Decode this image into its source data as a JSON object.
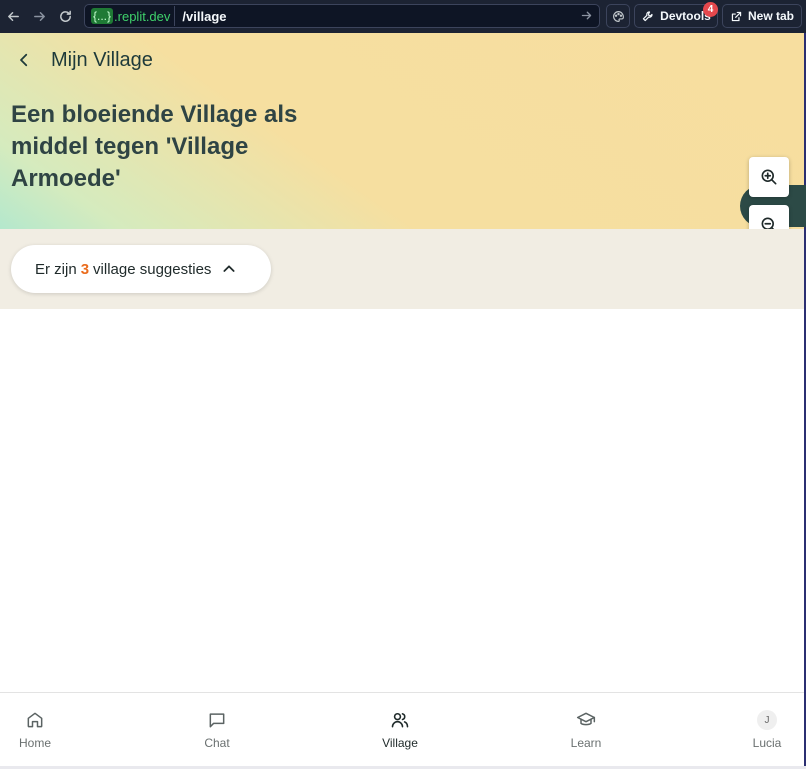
{
  "browser": {
    "domain_prefix": "{...}",
    "domain_suffix": ".replit.dev",
    "path": "/village",
    "devtools_label": "Devtools",
    "devtools_badge": "4",
    "newtab_label": "New tab"
  },
  "header": {
    "title": "Mijn Village",
    "heading": "Een bloeiende Village als middel tegen 'Village Armoede'"
  },
  "suggestions": {
    "prefix": "Er zijn",
    "count": "3",
    "suffix": "village suggesties"
  },
  "nav": {
    "items": [
      {
        "label": "Home",
        "icon": "home-icon"
      },
      {
        "label": "Chat",
        "icon": "chat-icon"
      },
      {
        "label": "Village",
        "icon": "users-icon",
        "active": true
      },
      {
        "label": "Learn",
        "icon": "graduation-cap-icon"
      },
      {
        "label": "Lucia",
        "icon": "avatar",
        "initial": "J"
      }
    ]
  },
  "colors": {
    "accent_count": "#ea6c1d",
    "hero_start": "#b4e8cd",
    "hero_end": "#f7de9f",
    "band": "#f1ede3",
    "toolbar": "#1c2333"
  }
}
